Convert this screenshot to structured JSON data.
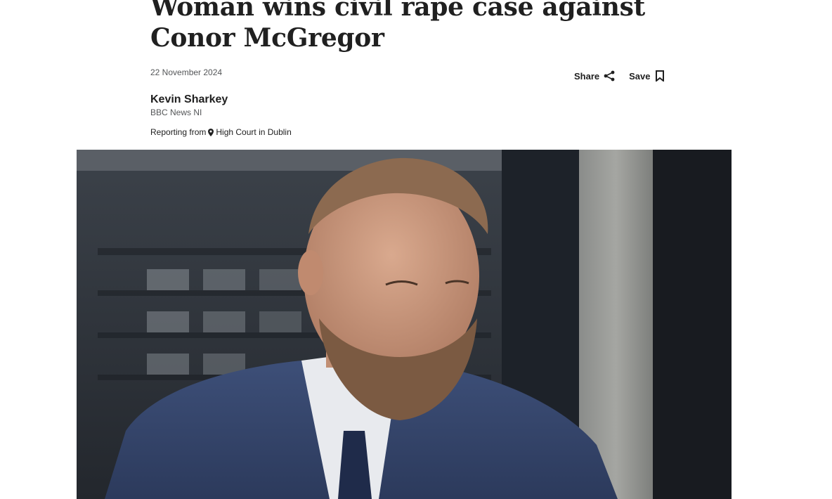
{
  "article": {
    "headline": "Woman wins civil rape case against Conor McGregor",
    "date": "22 November 2024",
    "author": {
      "name": "Kevin Sharkey",
      "organisation": "BBC News NI"
    },
    "reporting": {
      "prefix": "Reporting from",
      "location": "High Court in Dublin"
    }
  },
  "actions": {
    "share_label": "Share",
    "save_label": "Save"
  },
  "icons": {
    "share": "share-icon",
    "save": "bookmark-icon",
    "location": "location-pin-icon"
  },
  "colors": {
    "text_primary": "#202020",
    "text_secondary": "#545658"
  }
}
